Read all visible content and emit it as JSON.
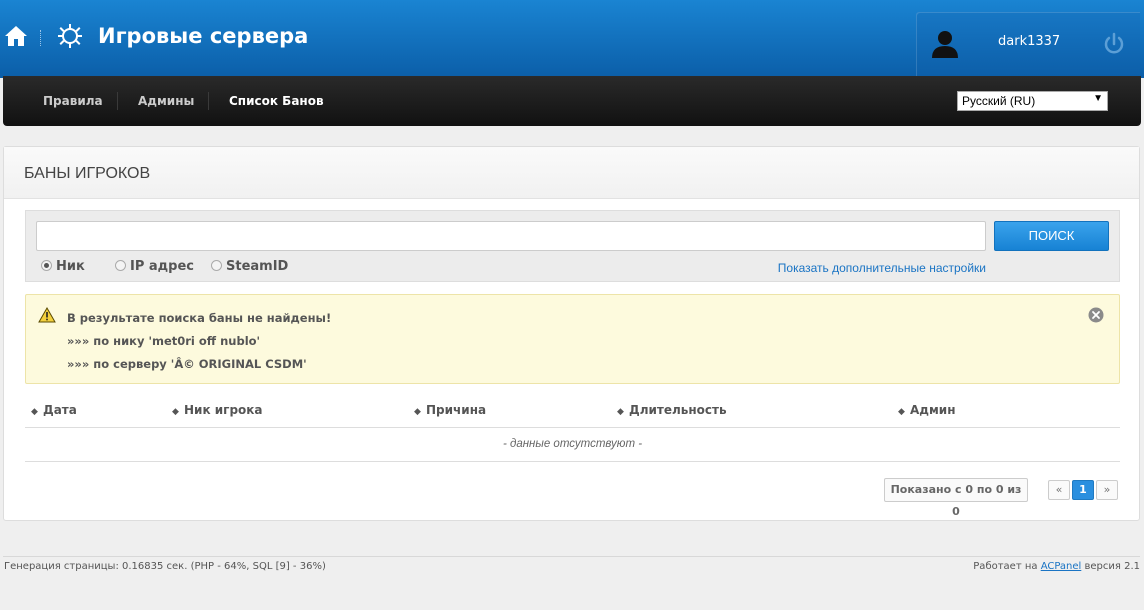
{
  "header": {
    "title": "Игровые сервера",
    "username": "dark1337"
  },
  "nav": {
    "items": [
      "Правила",
      "Админы",
      "Список Банов"
    ],
    "active_index": 2,
    "language": "Русский (RU)"
  },
  "panel": {
    "title": "БАНЫ ИГРОКОВ",
    "search": {
      "value": "",
      "button_label": "ПОИСК",
      "options": [
        "Ник",
        "IP адрес",
        "SteamID"
      ],
      "selected_option": "Ник",
      "more_settings_link": "Показать дополнительные настройки"
    },
    "alert": {
      "lines": [
        "В результате поиска баны не найдены!",
        "»»» по нику 'met0ri off nublo'",
        "»»» по серверу 'Â© ORIGINAL CSDM'"
      ]
    },
    "table": {
      "columns": [
        "Дата",
        "Ник игрока",
        "Причина",
        "Длительность",
        "Админ"
      ],
      "empty_text": "- данные отсутствуют -"
    },
    "pagination": {
      "info": "Показано с 0 по 0 из 0",
      "prev": "«",
      "current_page": "1",
      "next": "»"
    }
  },
  "footer": {
    "left": "Генерация страницы: 0.16835 сек. (PHP - 64%, SQL [9] - 36%)",
    "right_prefix": "Работает на",
    "right_link": "ACPanel",
    "right_suffix": "версия 2.1"
  },
  "colors": {
    "header_blue": "#0b5ea8",
    "search_button": "#1782d4",
    "alert_bg": "#fdfadd",
    "link": "#1a74c4"
  }
}
